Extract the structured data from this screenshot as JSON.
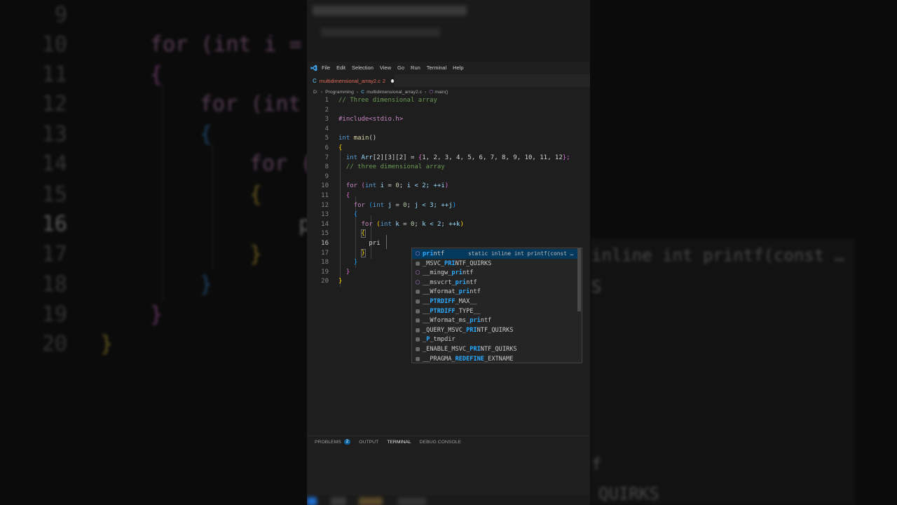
{
  "background": {
    "lines": [
      {
        "num": "9",
        "text": ""
      },
      {
        "num": "10",
        "text": "for (int i ="
      },
      {
        "num": "11",
        "text": "{"
      },
      {
        "num": "12",
        "text": "for (int"
      },
      {
        "num": "13",
        "text": "{"
      },
      {
        "num": "14",
        "text": "for ("
      },
      {
        "num": "15",
        "text": "{"
      },
      {
        "num": "16",
        "text": "p"
      },
      {
        "num": "17",
        "text": "}"
      },
      {
        "num": "18",
        "text": "}"
      },
      {
        "num": "19",
        "text": "}"
      },
      {
        "num": "20",
        "text": "}"
      }
    ],
    "suggest_detail": "inline int printf(const …",
    "suggest_rows": [
      "S",
      "f",
      "QUIRKS"
    ]
  },
  "menubar": {
    "logo_icon": "vscode-logo-icon",
    "items": [
      "File",
      "Edit",
      "Selection",
      "View",
      "Go",
      "Run",
      "Terminal",
      "Help"
    ]
  },
  "tab": {
    "icon": "C",
    "filename": "multidimensional_array2.c",
    "problem_count": "2",
    "dirty": true
  },
  "breadcrumb": {
    "drive": "D:",
    "folder": "Programming",
    "file_icon": "C",
    "file": "multidimensional_array2.c",
    "symbol": "main()"
  },
  "editor": {
    "active_line": "16",
    "lines": [
      {
        "n": "1",
        "comment": "// Three dimensional array"
      },
      {
        "n": "2"
      },
      {
        "n": "3",
        "include": "#include<stdio.h>"
      },
      {
        "n": "4"
      },
      {
        "n": "5",
        "type": "int",
        "fn": "main",
        "rest": "()"
      },
      {
        "n": "6",
        "brace": "{"
      },
      {
        "n": "7",
        "type": "int",
        "var": "Arr",
        "dims": "[2][3][2]",
        "eq": " = ",
        "open": "{",
        "nums": "1, 2, 3, 4, 5, 6, 7, 8, 9, 10, 11, 12",
        "close": "};"
      },
      {
        "n": "8",
        "comment": "// three dimensional array"
      },
      {
        "n": "9"
      },
      {
        "n": "10",
        "kw": "for",
        "type": "int",
        "loop": "i",
        "cond": "i < 2; ++i"
      },
      {
        "n": "11",
        "brace": "{"
      },
      {
        "n": "12",
        "kw": "for",
        "type": "int",
        "loop": "j",
        "cond": "j < 3; ++j"
      },
      {
        "n": "13",
        "brace": "{"
      },
      {
        "n": "14",
        "kw": "for",
        "type": "int",
        "loop": "k",
        "cond": "k < 2; ++k"
      },
      {
        "n": "15",
        "brace": "{"
      },
      {
        "n": "16",
        "typed": "pri"
      },
      {
        "n": "17",
        "brace": "}"
      },
      {
        "n": "18",
        "brace": "}"
      },
      {
        "n": "19",
        "brace": "}"
      },
      {
        "n": "20",
        "brace": "}"
      }
    ]
  },
  "suggestions": {
    "selected_detail": "static inline int printf(const …",
    "items": [
      {
        "icon": "cube-icon",
        "pre": "",
        "match": "pri",
        "post": "ntf"
      },
      {
        "icon": "constant-icon",
        "pre": "_MSVC_",
        "match": "PRI",
        "post": "NTF_QUIRKS"
      },
      {
        "icon": "cube-icon",
        "pre": "__mingw_",
        "match": "pri",
        "post": "ntf"
      },
      {
        "icon": "cube-icon",
        "pre": "__msvcrt_",
        "match": "pri",
        "post": "ntf"
      },
      {
        "icon": "constant-icon",
        "pre": "__Wformat_",
        "match": "pri",
        "post": "ntf"
      },
      {
        "icon": "constant-icon",
        "pre": "__",
        "match": "PTRDIFF",
        "post": "_MAX__"
      },
      {
        "icon": "constant-icon",
        "pre": "__",
        "match": "PTRDIFF",
        "post": "_TYPE__"
      },
      {
        "icon": "constant-icon",
        "pre": "__Wformat_ms_",
        "match": "pri",
        "post": "ntf"
      },
      {
        "icon": "constant-icon",
        "pre": "_QUERY_MSVC_",
        "match": "PRI",
        "post": "NTF_QUIRKS"
      },
      {
        "icon": "constant-icon",
        "pre": "_",
        "match": "P",
        "post": "_tmpdir"
      },
      {
        "icon": "constant-icon",
        "pre": "_ENABLE_MSVC_",
        "match": "PRI",
        "post": "NTF_QUIRKS"
      },
      {
        "icon": "constant-icon",
        "pre": "__PRAGMA_",
        "match": "REDEFINE",
        "post": "_EXTNAME"
      }
    ]
  },
  "panel": {
    "tabs": [
      "PROBLEMS",
      "OUTPUT",
      "TERMINAL",
      "DEBUG CONSOLE"
    ],
    "problems_badge": "2",
    "active_tab": "TERMINAL"
  }
}
